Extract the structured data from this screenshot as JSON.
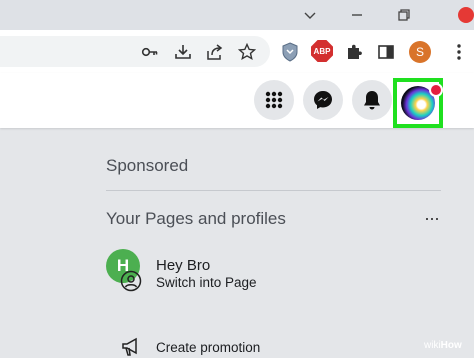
{
  "browser": {
    "toolbar": {
      "extension_abp": "ABP",
      "profile_initial": "S"
    }
  },
  "colors": {
    "highlight": "#1fe01f",
    "notification": "#e41e3f",
    "page_avatar": "#4caf50",
    "profile": "#d9742a"
  },
  "icons": {
    "window": [
      "chevron-down-icon",
      "minimize-icon",
      "restore-icon",
      "close-icon"
    ],
    "toolbar": [
      "key-icon",
      "install-icon",
      "share-icon",
      "star-icon",
      "privacy-badger-icon",
      "adblock-plus-icon",
      "extensions-puzzle-icon",
      "side-panel-icon",
      "profile-avatar",
      "more-menu-icon"
    ],
    "facebook": [
      "apps-grid-icon",
      "messenger-icon",
      "bell-icon",
      "account-avatar"
    ]
  },
  "menu": {
    "sponsored_heading": "Sponsored",
    "pages_heading": "Your Pages and profiles",
    "more_label": "···",
    "page": {
      "initial": "H",
      "name": "Hey Bro"
    },
    "options": [
      {
        "label": "Switch into Page",
        "icon": "switch-profile-icon"
      },
      {
        "label": "Create promotion",
        "icon": "megaphone-icon"
      }
    ]
  },
  "watermark": {
    "prefix": "wiki",
    "suffix": "How"
  }
}
